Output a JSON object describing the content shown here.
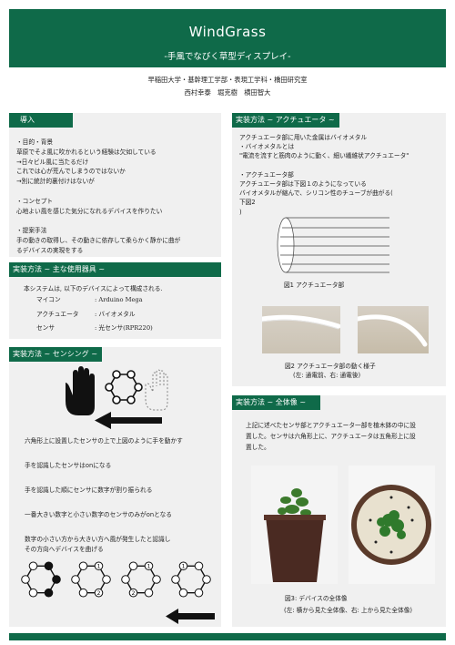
{
  "header": {
    "title": "WindGrass",
    "subtitle": "-手風でなびく草型ディスプレイ-"
  },
  "affiliation": {
    "line1": "早稲田大学・基幹理工学部・表現工学科・橋田研究室",
    "line2": "西村幸泰　堀克樹　横田智大"
  },
  "intro": {
    "heading": "導入",
    "lines": [
      "・目的・背景",
      "  草原でそよ風に吹かれるという経験は欠如している",
      "        →日々ビル風に当たるだけ",
      "  これでは心が荒んでしまうのではないか",
      "        →別に統計的裏付けはないが",
      "",
      "・コンセプト",
      "  心地よい風を感じた気分になれるデバイスを作りたい",
      "",
      "・提案手法",
      "  手の動きの取得し、その動きに依存して柔らかく静かに曲が",
      "るデバイスの実現をする"
    ]
  },
  "devices": {
    "heading": "実装方法 ~ 主な使用器具 ~",
    "intro": "本システムは, 以下のデバイスによって構成される.",
    "rows": [
      {
        "name": "マイコン",
        "value": ": Arduino Mega"
      },
      {
        "name": "アクチュエータ",
        "value": ": バイオメタル"
      },
      {
        "name": "センサ",
        "value": ": 光センサ(RPR220)"
      }
    ]
  },
  "sensing": {
    "heading": "実装方法 ~ センシング ~",
    "steps": [
      "六角形上に設置したセンサの上で上図のように手を動かす",
      "手を認識したセンサはonになる",
      "手を認識した順にセンサに数字が割り振られる",
      "一番大きい数字と小さい数字のセンサのみがonとなる",
      "数字の小さい方から大きい方へ風が発生したと認識し",
      "その方向へデバイスを曲げる"
    ],
    "hex_labels": [
      [
        "",
        "",
        "",
        "",
        "",
        ""
      ],
      [
        "",
        "",
        "1",
        "",
        "2",
        ""
      ],
      [
        "",
        "",
        "1",
        "",
        "",
        "2"
      ],
      [
        "",
        "1",
        "",
        "",
        "",
        ""
      ]
    ]
  },
  "actuator": {
    "heading": "実装方法 ~ アクチュエータ ~",
    "lines": [
      "アクチュエータ部に用いた金属はバイオメタル",
      "・バイオメタルとは",
      "  \"電流を流すと筋肉のように動く、細い繊維状アクチュエータ\"",
      "",
      "・アクチュエータ部",
      "  アクチュエータ部は下図１のようになっている",
      "  バイオメタルが縮んで、シリコン性のチューブが曲がる(",
      "下図2",
      ")"
    ],
    "fig1_caption": "図1 アクチュエータ部",
    "fig2_caption_line1": "図2 アクチュエータ部の動く様子",
    "fig2_caption_line2": "(左: 通電前、右: 通電後)"
  },
  "overall": {
    "heading": "実装方法 ~ 全体像 ~",
    "lines": [
      "上記に述べたセンサ部とアクチュエータ一部を植木鉢の中に設",
      "置した。センサは六角形上に、アクチュエータは五角形上に設",
      "置した。"
    ],
    "fig3_caption_line1": "図3: デバイスの全体像",
    "fig3_caption_line2": "(左: 横から見た全体像、右: 上から見た全体像)"
  },
  "colors": {
    "accent": "#0f6a49",
    "panel": "#f0f0f0"
  }
}
